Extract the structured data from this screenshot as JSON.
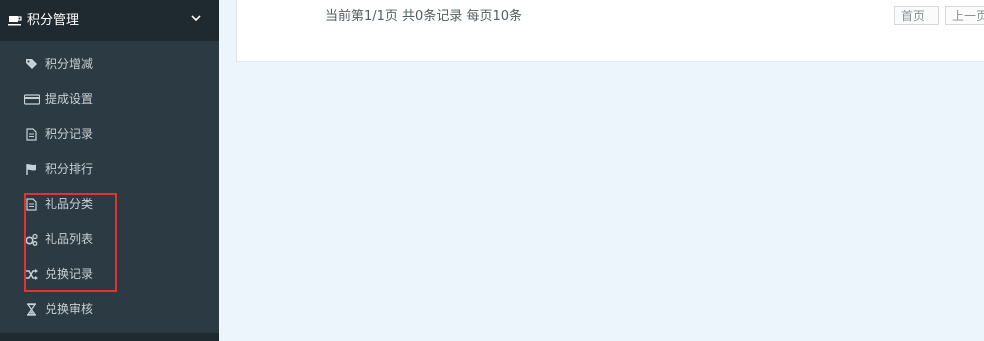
{
  "sidebar": {
    "header": {
      "title": "积分管理",
      "icon": "coffee-cup-icon",
      "chevron": "chevron-down-icon"
    },
    "items": [
      {
        "label": "积分增减",
        "icon": "tag-icon"
      },
      {
        "label": "提成设置",
        "icon": "credit-card-icon"
      },
      {
        "label": "积分记录",
        "icon": "document-icon"
      },
      {
        "label": "积分排行",
        "icon": "flag-icon"
      },
      {
        "label": "礼品分类",
        "icon": "file-text-icon"
      },
      {
        "label": "礼品列表",
        "icon": "cogs-icon"
      },
      {
        "label": "兑换记录",
        "icon": "shuffle-icon"
      },
      {
        "label": "兑换审核",
        "icon": "hourglass-icon"
      }
    ]
  },
  "pager": {
    "info": "当前第1/1页 共0条记录 每页10条",
    "first_label": "首页",
    "prev_label": "上一页"
  },
  "colors": {
    "sidebar_bg": "#2c3b43",
    "sidebar_header_bg": "#1f2a30",
    "content_bg": "#edf5fc",
    "highlight": "#e0342f"
  }
}
